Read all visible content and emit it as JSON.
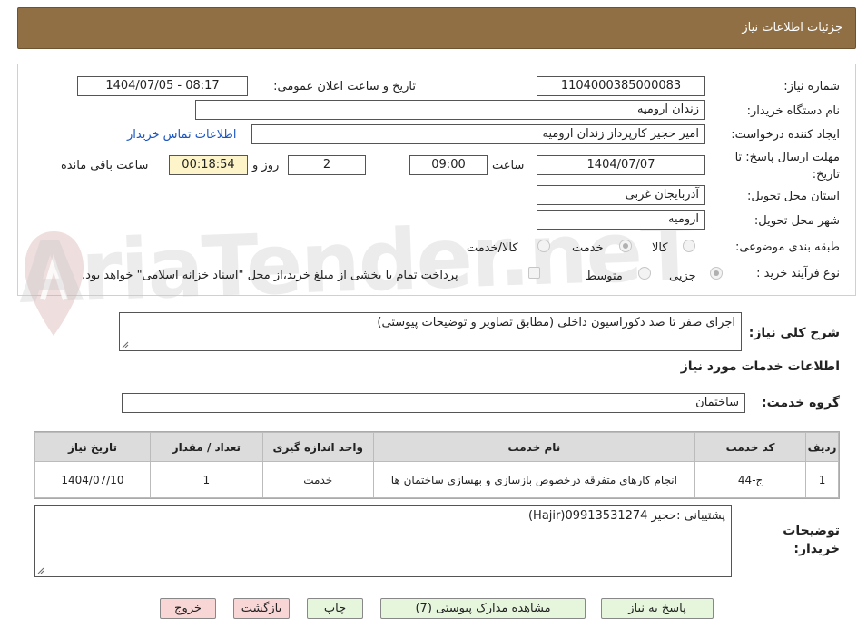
{
  "header": {
    "title": "جزئیات اطلاعات نیاز"
  },
  "form": {
    "need_number": {
      "label": "شماره نیاز:",
      "value": "1104000385000083"
    },
    "announce_datetime": {
      "label": "تاریخ و ساعت اعلان عمومی:",
      "value": "1404/07/05 - 08:17"
    },
    "buyer_org": {
      "label": "نام دستگاه خریدار:",
      "value": "زندان ارومیه"
    },
    "requester": {
      "label": "ایجاد کننده درخواست:",
      "value": "امیر حجیر کارپرداز زندان ارومیه",
      "contact_link": "اطلاعات تماس خریدار"
    },
    "deadline": {
      "label_line1": "مهلت ارسال پاسخ: تا",
      "label_line2": "تاریخ:",
      "date": "1404/07/07",
      "time_label": "ساعت",
      "time": "09:00",
      "days": "2",
      "days_label": "روز و",
      "remaining": "00:18:54",
      "remaining_label": "ساعت باقی مانده"
    },
    "province": {
      "label": "استان محل تحویل:",
      "value": "آذربایجان غربی"
    },
    "city": {
      "label": "شهر محل تحویل:",
      "value": "ارومیه"
    },
    "category": {
      "label": "طبقه بندی موضوعی:",
      "options": [
        "کالا",
        "خدمت",
        "کالا/خدمت"
      ],
      "selected": "خدمت"
    },
    "process": {
      "label": "نوع فرآیند خرید :",
      "options": [
        "جزیی",
        "متوسط"
      ],
      "selected": "جزیی",
      "note": "پرداخت تمام یا بخشی از مبلغ خرید،از محل \"اسناد خزانه اسلامی\" خواهد بود."
    }
  },
  "summary": {
    "label": "شرح کلی نیاز:",
    "value": "اجرای صفر تا صد دکوراسیون داخلی (مطابق تصاویر و توضیحات پیوستی)"
  },
  "services_section": {
    "title": "اطلاعات خدمات مورد نیاز"
  },
  "service_group": {
    "label": "گروه خدمت:",
    "value": "ساختمان"
  },
  "table": {
    "headers": [
      "ردیف",
      "کد خدمت",
      "نام خدمت",
      "واحد اندازه گیری",
      "تعداد / مقدار",
      "تاریخ نیاز"
    ],
    "rows": [
      [
        "1",
        "ج-44",
        "انجام کارهای متفرقه درخصوص بازسازی و بهسازی ساختمان ها",
        "خدمت",
        "1",
        "1404/07/10"
      ]
    ]
  },
  "buyer_notes": {
    "label_line1": "توضیحات",
    "label_line2": "خریدار:",
    "value": "پشتیبانی :حجیر 09913531274(Hajir)"
  },
  "buttons": {
    "reply": "پاسخ به نیاز",
    "attachments": "مشاهده مدارک پیوستی (7)",
    "print": "چاپ",
    "back": "بازگشت",
    "exit": "خروج"
  },
  "watermark": "AriaTender.neT",
  "colors": {
    "header_bg": "#8f6f43",
    "timer_bg": "#fdf5c9",
    "link": "#1a55c0",
    "button_green": "#e6f6dc",
    "button_pink": "#f9d6d6"
  }
}
